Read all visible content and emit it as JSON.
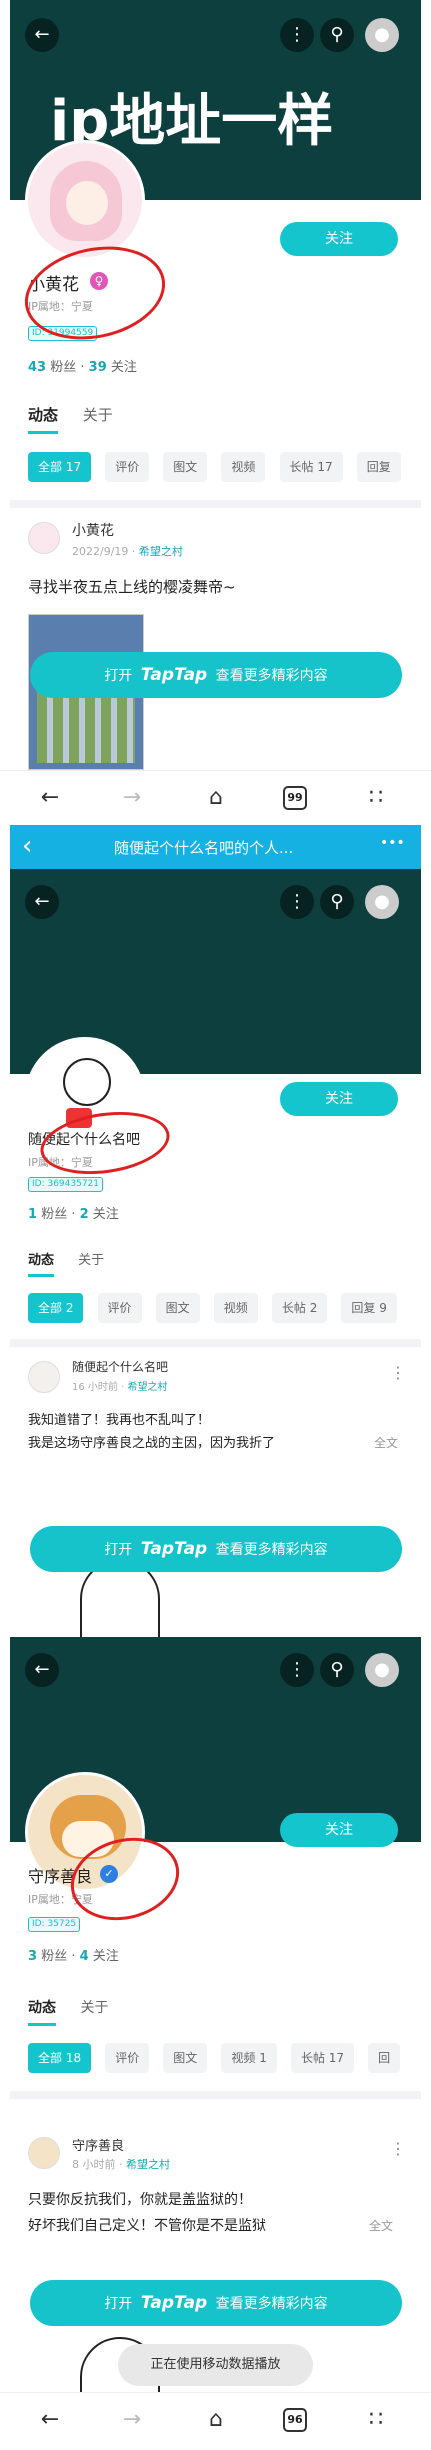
{
  "panel1": {
    "banner_text": "ip地址一样",
    "follow": "关注",
    "name": "小黄花",
    "ip": "IP属地：宁夏",
    "id": "ID: 31994559",
    "fans_n": "43",
    "fans_l": "粉丝",
    "follow_n": "39",
    "follow_l": "关注",
    "tabs": [
      "动态",
      "关于"
    ],
    "chips": [
      "全部 17",
      "评价",
      "图文",
      "视频",
      "长帖 17",
      "回复"
    ],
    "post_name": "小黄花",
    "post_date": "2022/9/19",
    "post_group": "希望之村",
    "post_text": "寻找半夜五点上线的樱凌舞帝~"
  },
  "openbar": {
    "prefix": "打开",
    "brand": "TapTap",
    "suffix": "查看更多精彩内容"
  },
  "nav1_tabs": "99",
  "wx_title": "随便起个什么名吧的个人...",
  "wx_back": "‹",
  "wx_more": "•••",
  "panel2": {
    "follow": "关注",
    "name": "随便起个什么名吧",
    "ip": "IP属地：宁夏",
    "id": "ID: 369435721",
    "fans_n": "1",
    "fans_l": "粉丝",
    "follow_n": "2",
    "follow_l": "关注",
    "tabs": [
      "动态",
      "关于"
    ],
    "chips": [
      "全部 2",
      "评价",
      "图文",
      "视频",
      "长帖 2",
      "回复 9"
    ],
    "post_name": "随便起个什么名吧",
    "post_date": "16 小时前",
    "post_group": "希望之村",
    "line1": "我知道错了！我再也不乱叫了！",
    "line2": "我是这场守序善良之战的主因，因为我折了",
    "more": "全文"
  },
  "panel3": {
    "follow": "关注",
    "name": "守序善良",
    "ip": "IP属地：宁夏",
    "id": "ID: 35725",
    "fans_n": "3",
    "fans_l": "粉丝",
    "follow_n": "4",
    "follow_l": "关注",
    "tabs": [
      "动态",
      "关于"
    ],
    "chips": [
      "全部 18",
      "评价",
      "图文",
      "视频 1",
      "长帖 17",
      "回"
    ],
    "post_name": "守序善良",
    "post_date": "8 小时前",
    "post_group": "希望之村",
    "line1": "只要你反抗我们，你就是盖监狱的！",
    "line2": "好坏我们自己定义！不管你是不是监狱",
    "more": "全文"
  },
  "toast": "正在使用移动数据播放",
  "nav3_tabs": "96",
  "icons": [
    "back-icon",
    "more-icon",
    "search-icon",
    "profile-icon",
    "forward-icon",
    "home-icon",
    "tabs-icon",
    "menu-icon"
  ],
  "colors": {
    "accent": "#15c5ce",
    "banner": "#0c3f3d",
    "wechat": "#16b1e3",
    "annotation": "#e02020"
  }
}
